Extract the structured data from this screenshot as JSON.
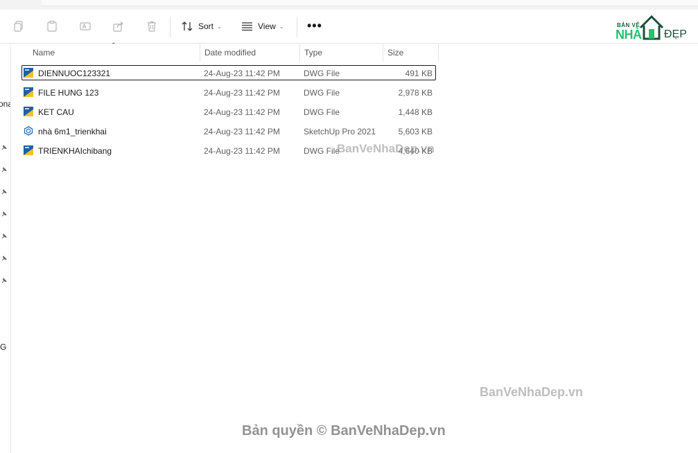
{
  "toolbar": {
    "sort_label": "Sort",
    "view_label": "View",
    "more_label": "•••"
  },
  "columns": {
    "name": "Name",
    "date_modified": "Date modified",
    "type": "Type",
    "size": "Size"
  },
  "files": [
    {
      "name": "DIENNUOC123321",
      "date": "24-Aug-23 11:42 PM",
      "type": "DWG File",
      "size": "491 KB",
      "icon": "dwg-file-icon",
      "selected": true
    },
    {
      "name": "FILE HUNG 123",
      "date": "24-Aug-23 11:42 PM",
      "type": "DWG File",
      "size": "2,978 KB",
      "icon": "dwg-file-icon"
    },
    {
      "name": "KET CAU",
      "date": "24-Aug-23 11:42 PM",
      "type": "DWG File",
      "size": "1,448 KB",
      "icon": "dwg-file-icon"
    },
    {
      "name": "nhà 6m1_trienkhai",
      "date": "24-Aug-23 11:42 PM",
      "type": "SketchUp Pro 2021",
      "size": "5,603 KB",
      "icon": "sketchup-file-icon"
    },
    {
      "name": "TRIENKHAIchibang",
      "date": "24-Aug-23 11:42 PM",
      "type": "DWG File",
      "size": "4,640 KB",
      "icon": "dwg-file-icon"
    }
  ],
  "left_pane": {
    "fragment_top": "ona",
    "fragment_bottom": "G"
  },
  "logo": {
    "small_text": "BẢN VẼ",
    "main_text": "NHÀ",
    "tail_text": "ĐẸP"
  },
  "watermarks": {
    "mid": "BanVeNhaDep.vn",
    "right": "BanVeNhaDep.vn",
    "bottom": "Bản quyền © BanVeNhaDep.vn"
  },
  "colors": {
    "dwg_blue": "#1f5fa8",
    "dwg_yellow": "#f2c12e",
    "sketchup_blue": "#1c6bb5",
    "logo_green": "#21c36b"
  }
}
